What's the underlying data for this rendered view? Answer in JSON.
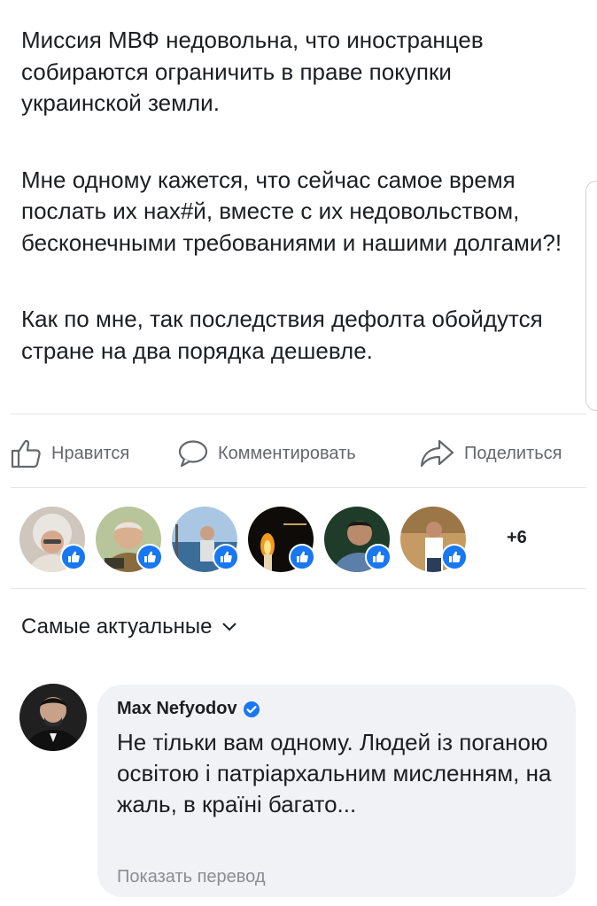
{
  "post": {
    "paragraphs": [
      "Миссия МВФ недовольна, что иностранцев собираются ограничить в праве покупки украинской земли.",
      "Мне одному кажется, что сейчас самое время послать их нах#й, вместе с их недовольством, бесконечными требованиями и нашими долгами?!",
      "Как по мне, так последствия дефолта обойдутся стране на два порядка дешевле."
    ]
  },
  "actions": {
    "like": "Нравится",
    "comment": "Комментировать",
    "share": "Поделиться"
  },
  "reactions": {
    "more_count": "+6"
  },
  "sort": {
    "label": "Самые актуальные"
  },
  "comment": {
    "author": "Max Nefyodov",
    "text": "Не тільки вам одному. Людей із поганою освітою і патріархальним мисленням, на жаль, в країні багато...",
    "translate": "Показать перевод"
  },
  "colors": {
    "brand_blue": "#1877f2",
    "secondary_text": "#65676b",
    "bubble_bg": "#f0f2f5"
  }
}
